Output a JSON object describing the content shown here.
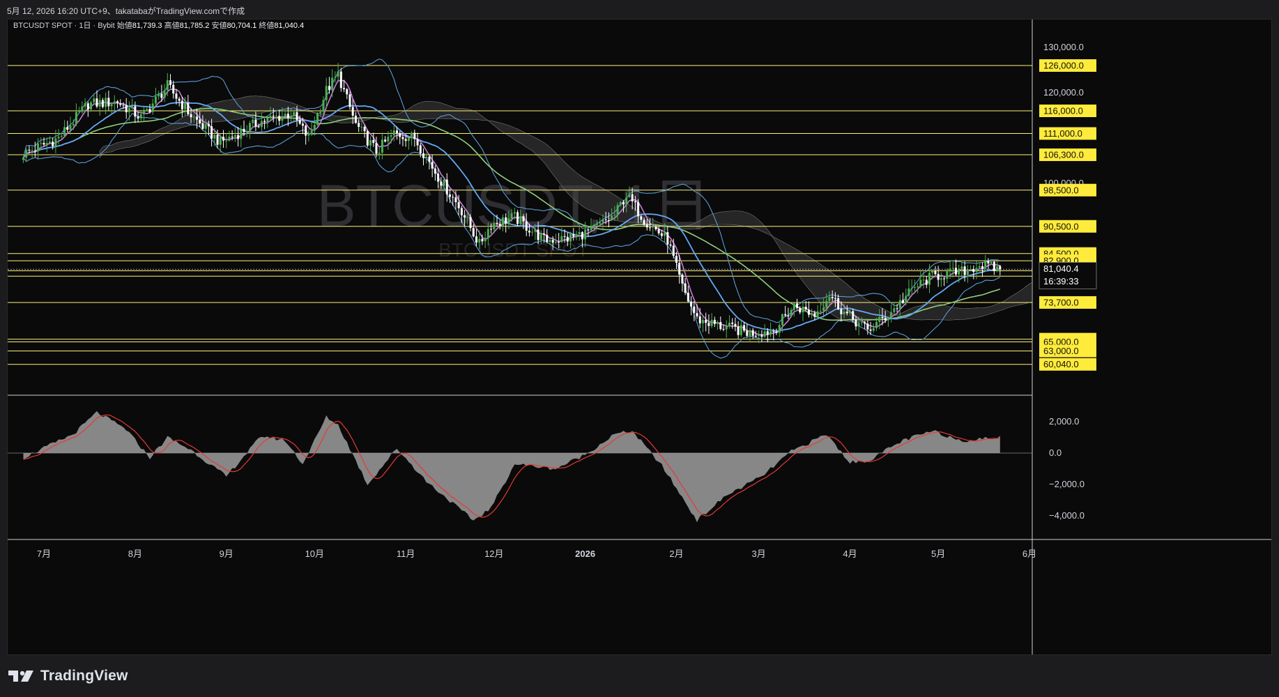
{
  "header": {
    "caption": "5月 12, 2026 16:20 UTC+9、takatabaがTradingView.comで作成"
  },
  "legend": {
    "symbol": "BTCUSDT SPOT · 1日 · Bybit",
    "open_label": "始値",
    "open": "81,739.3",
    "high_label": "高値",
    "high": "81,785.2",
    "low_label": "安値",
    "low": "80,704.1",
    "close_label": "終値",
    "close": "81,040.4"
  },
  "watermark": {
    "main": "BTCUSDT, 1日",
    "sub": "BTCUSDT SPOT"
  },
  "footer": {
    "brand": "TradingView"
  },
  "colors": {
    "background": "#0a0a0a",
    "up_candle": "#4caf50",
    "down_candle": "#ffffff",
    "level_line": "#fff176",
    "level_label_bg": "#ffeb3b",
    "bollinger": "#5b9bd5",
    "ma_short": "#c77dd6",
    "ma_mid": "#64a8f5",
    "ma_long": "#8fcf7a",
    "macd_hist": "#9e9e9e",
    "macd_signal": "#e53935"
  },
  "chart_data": {
    "type": "candlestick",
    "x_axis_labels": [
      "7月",
      "8月",
      "9月",
      "10月",
      "11月",
      "12月",
      "2026",
      "2月",
      "3月",
      "4月",
      "5月",
      "6月"
    ],
    "x_axis_days": [
      0,
      31,
      62,
      92,
      123,
      153,
      184,
      215,
      243,
      274,
      304,
      335
    ],
    "price_axis_labels": [
      {
        "value": 130000,
        "label": "130,000.0"
      },
      {
        "value": 120000,
        "label": "120,000.0"
      },
      {
        "value": 100000,
        "label": "100,000.0"
      }
    ],
    "price_levels": [
      {
        "value": 126000,
        "label": "126,000.0"
      },
      {
        "value": 116000,
        "label": "116,000.0"
      },
      {
        "value": 111000,
        "label": "111,000.0"
      },
      {
        "value": 106300,
        "label": "106,300.0"
      },
      {
        "value": 98500,
        "label": "98,500.0"
      },
      {
        "value": 90500,
        "label": "90,500.0"
      },
      {
        "value": 84500,
        "label": "84,500.0"
      },
      {
        "value": 82900,
        "label": "82,900.0"
      },
      {
        "value": 80700,
        "label": "80,700.0"
      },
      {
        "value": 79500,
        "label": "79,500.0"
      },
      {
        "value": 73700,
        "label": "73,700.0"
      },
      {
        "value": 65600,
        "label": "65,600.0"
      },
      {
        "value": 65000,
        "label": "65,000.0"
      },
      {
        "value": 63000,
        "label": "63,000.0"
      },
      {
        "value": 60040,
        "label": "60,040.0"
      }
    ],
    "current_price": {
      "value": 81040.4,
      "label": "81,040.4",
      "countdown": "16:39:33"
    },
    "price_keypoints": [
      {
        "day": -7,
        "price": 106500
      },
      {
        "day": 5,
        "price": 110000
      },
      {
        "day": 15,
        "price": 117500
      },
      {
        "day": 25,
        "price": 118000
      },
      {
        "day": 33,
        "price": 114500
      },
      {
        "day": 42,
        "price": 121500
      },
      {
        "day": 50,
        "price": 115000
      },
      {
        "day": 60,
        "price": 109000
      },
      {
        "day": 73,
        "price": 113500
      },
      {
        "day": 84,
        "price": 115500
      },
      {
        "day": 90,
        "price": 110000
      },
      {
        "day": 96,
        "price": 120500
      },
      {
        "day": 100,
        "price": 124000
      },
      {
        "day": 106,
        "price": 113000
      },
      {
        "day": 113,
        "price": 107000
      },
      {
        "day": 119,
        "price": 111000
      },
      {
        "day": 126,
        "price": 110000
      },
      {
        "day": 134,
        "price": 101500
      },
      {
        "day": 142,
        "price": 94000
      },
      {
        "day": 148,
        "price": 86500
      },
      {
        "day": 152,
        "price": 91000
      },
      {
        "day": 160,
        "price": 92500
      },
      {
        "day": 170,
        "price": 87500
      },
      {
        "day": 178,
        "price": 87800
      },
      {
        "day": 186,
        "price": 89500
      },
      {
        "day": 194,
        "price": 93000
      },
      {
        "day": 198,
        "price": 97500
      },
      {
        "day": 204,
        "price": 92000
      },
      {
        "day": 212,
        "price": 87500
      },
      {
        "day": 217,
        "price": 77000
      },
      {
        "day": 222,
        "price": 70000
      },
      {
        "day": 230,
        "price": 68500
      },
      {
        "day": 240,
        "price": 67000
      },
      {
        "day": 248,
        "price": 67500
      },
      {
        "day": 255,
        "price": 73000
      },
      {
        "day": 262,
        "price": 71000
      },
      {
        "day": 267,
        "price": 75500
      },
      {
        "day": 272,
        "price": 71500
      },
      {
        "day": 280,
        "price": 67500
      },
      {
        "day": 287,
        "price": 71000
      },
      {
        "day": 296,
        "price": 77000
      },
      {
        "day": 302,
        "price": 79500
      },
      {
        "day": 312,
        "price": 80500
      },
      {
        "day": 318,
        "price": 82000
      },
      {
        "day": 325,
        "price": 81040
      }
    ],
    "macd_axis_labels": [
      {
        "value": 2000,
        "label": "2,000.0"
      },
      {
        "value": 0,
        "label": "0.0"
      },
      {
        "value": -2000,
        "label": "−2,000.0"
      },
      {
        "value": -4000,
        "label": "−4,000.0"
      }
    ],
    "macd_keypoints": [
      {
        "day": -7,
        "value": -300
      },
      {
        "day": 2,
        "value": 500
      },
      {
        "day": 10,
        "value": 1200
      },
      {
        "day": 18,
        "value": 2600
      },
      {
        "day": 28,
        "value": 1500
      },
      {
        "day": 36,
        "value": -300
      },
      {
        "day": 42,
        "value": 1000
      },
      {
        "day": 50,
        "value": 200
      },
      {
        "day": 62,
        "value": -1500
      },
      {
        "day": 74,
        "value": 1100
      },
      {
        "day": 82,
        "value": 800
      },
      {
        "day": 88,
        "value": -700
      },
      {
        "day": 96,
        "value": 2300
      },
      {
        "day": 100,
        "value": 1800
      },
      {
        "day": 110,
        "value": -2000
      },
      {
        "day": 120,
        "value": 300
      },
      {
        "day": 130,
        "value": -1800
      },
      {
        "day": 146,
        "value": -4300
      },
      {
        "day": 152,
        "value": -3500
      },
      {
        "day": 160,
        "value": -700
      },
      {
        "day": 174,
        "value": -1000
      },
      {
        "day": 184,
        "value": -100
      },
      {
        "day": 194,
        "value": 1200
      },
      {
        "day": 200,
        "value": 1400
      },
      {
        "day": 210,
        "value": -800
      },
      {
        "day": 222,
        "value": -4300
      },
      {
        "day": 232,
        "value": -2700
      },
      {
        "day": 244,
        "value": -1500
      },
      {
        "day": 254,
        "value": 100
      },
      {
        "day": 266,
        "value": 1200
      },
      {
        "day": 274,
        "value": -600
      },
      {
        "day": 280,
        "value": -500
      },
      {
        "day": 292,
        "value": 800
      },
      {
        "day": 302,
        "value": 1400
      },
      {
        "day": 312,
        "value": 800
      },
      {
        "day": 325,
        "value": 1000
      }
    ]
  }
}
